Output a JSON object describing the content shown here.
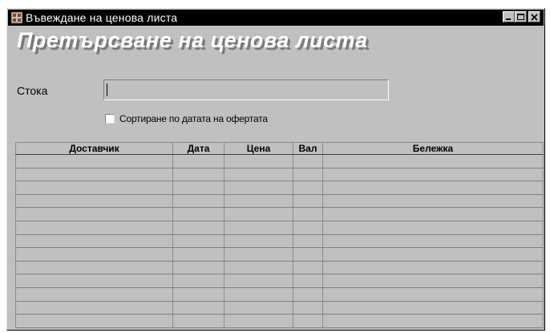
{
  "window": {
    "title": "Въвеждане на ценова листа",
    "buttons": [
      "minimize",
      "maximize",
      "close"
    ]
  },
  "form": {
    "heading": "Претърсване на ценова листа",
    "product_label": "Стока",
    "product_value": "",
    "sort_checkbox_label": "Сортиране по датата на офертата",
    "sort_checked": false
  },
  "table": {
    "columns": [
      "Доставчик",
      "Дата",
      "Цена",
      "Вал",
      "Бележка"
    ],
    "rows": [
      [
        "",
        "",
        "",
        "",
        ""
      ],
      [
        "",
        "",
        "",
        "",
        ""
      ],
      [
        "",
        "",
        "",
        "",
        ""
      ],
      [
        "",
        "",
        "",
        "",
        ""
      ],
      [
        "",
        "",
        "",
        "",
        ""
      ],
      [
        "",
        "",
        "",
        "",
        ""
      ],
      [
        "",
        "",
        "",
        "",
        ""
      ],
      [
        "",
        "",
        "",
        "",
        ""
      ],
      [
        "",
        "",
        "",
        "",
        ""
      ],
      [
        "",
        "",
        "",
        "",
        ""
      ],
      [
        "",
        "",
        "",
        "",
        ""
      ],
      [
        "",
        "",
        "",
        "",
        ""
      ],
      [
        "",
        "",
        "",
        "",
        ""
      ]
    ]
  },
  "colors": {
    "titlebar": "#000000",
    "window_bg": "#c0c0c0",
    "heading_shadow": "#7a7a7a"
  }
}
